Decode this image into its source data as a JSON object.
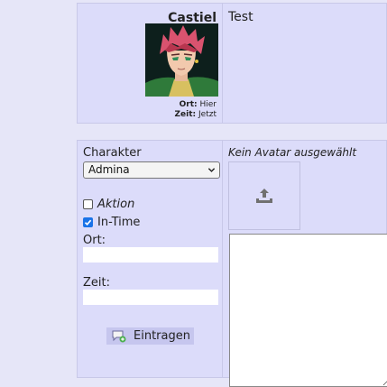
{
  "post": {
    "character_name": "Castiel",
    "ort_label": "Ort:",
    "ort_value": "Hier",
    "zeit_label": "Zeit:",
    "zeit_value": "Jetzt",
    "text": "Test"
  },
  "form": {
    "charakter_label": "Charakter",
    "charakter_selected": "Admina",
    "aktion_label": "Aktion",
    "aktion_checked": false,
    "intime_label": "In-Time",
    "intime_checked": true,
    "ort_label": "Ort:",
    "ort_value": "",
    "zeit_label": "Zeit:",
    "zeit_value": "",
    "submit_label": "Eintragen",
    "no_avatar_text": "Kein Avatar ausgewählt",
    "message_value": ""
  },
  "icons": {
    "select_chevron": "chevron-down-icon",
    "checkbox_check": "check-icon",
    "submit": "comment-add-icon",
    "upload": "upload-icon"
  },
  "colors": {
    "page_bg": "#e6e6f8",
    "panel_bg": "#dcdcfa",
    "button_bg": "#c6c6ee",
    "checkbox_checked": "#1a73e8"
  }
}
